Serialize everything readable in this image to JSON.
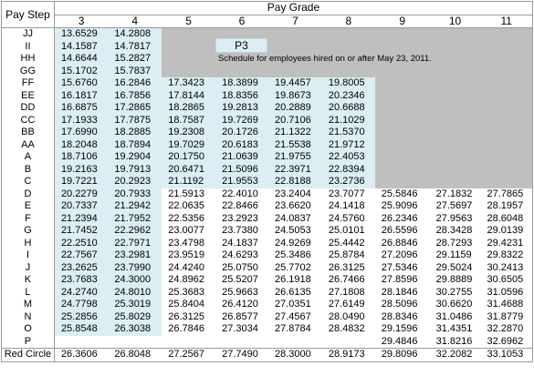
{
  "header": {
    "pay_step_label": "Pay Step",
    "pay_grade_label": "Pay Grade",
    "grades": [
      "3",
      "4",
      "5",
      "6",
      "7",
      "8",
      "9",
      "10",
      "11"
    ]
  },
  "overlay": {
    "schedule_code": "P3",
    "note": "Schedule for employees hired on or after May 23, 2011."
  },
  "rows": [
    {
      "step": "JJ",
      "values": [
        "13.6529",
        "14.2808",
        "",
        "",
        "",
        "",
        "",
        "",
        ""
      ]
    },
    {
      "step": "II",
      "values": [
        "14.1587",
        "14.7817",
        "",
        "",
        "",
        "",
        "",
        "",
        ""
      ]
    },
    {
      "step": "HH",
      "values": [
        "14.6644",
        "15.2827",
        "",
        "",
        "",
        "",
        "",
        "",
        ""
      ]
    },
    {
      "step": "GG",
      "values": [
        "15.1702",
        "15.7837",
        "",
        "",
        "",
        "",
        "",
        "",
        ""
      ]
    },
    {
      "step": "FF",
      "values": [
        "15.6760",
        "16.2846",
        "17.3423",
        "18.3899",
        "19.4457",
        "19.8005",
        "",
        "",
        ""
      ]
    },
    {
      "step": "EE",
      "values": [
        "16.1817",
        "16.7856",
        "17.8144",
        "18.8356",
        "19.8673",
        "20.2346",
        "",
        "",
        ""
      ]
    },
    {
      "step": "DD",
      "values": [
        "16.6875",
        "17.2865",
        "18.2865",
        "19.2813",
        "20.2889",
        "20.6688",
        "",
        "",
        ""
      ]
    },
    {
      "step": "CC",
      "values": [
        "17.1933",
        "17.7875",
        "18.7587",
        "19.7269",
        "20.7106",
        "21.1029",
        "",
        "",
        ""
      ]
    },
    {
      "step": "BB",
      "values": [
        "17.6990",
        "18.2885",
        "19.2308",
        "20.1726",
        "21.1322",
        "21.5370",
        "",
        "",
        ""
      ]
    },
    {
      "step": "AA",
      "values": [
        "18.2048",
        "18.7894",
        "19.7029",
        "20.6183",
        "21.5538",
        "21.9712",
        "",
        "",
        ""
      ]
    },
    {
      "step": "A",
      "values": [
        "18.7106",
        "19.2904",
        "20.1750",
        "21.0639",
        "21.9755",
        "22.4053",
        "",
        "",
        ""
      ]
    },
    {
      "step": "B",
      "values": [
        "19.2163",
        "19.7913",
        "20.6471",
        "21.5096",
        "22.3971",
        "22.8394",
        "",
        "",
        ""
      ]
    },
    {
      "step": "C",
      "values": [
        "19.7221",
        "20.2923",
        "21.1192",
        "21.9553",
        "22.8188",
        "23.2736",
        "",
        "",
        ""
      ]
    },
    {
      "step": "D",
      "values": [
        "20.2279",
        "20.7933",
        "21.5913",
        "22.4010",
        "23.2404",
        "23.7077",
        "25.5846",
        "27.1832",
        "27.7865"
      ]
    },
    {
      "step": "E",
      "values": [
        "20.7337",
        "21.2942",
        "22.0635",
        "22.8466",
        "23.6620",
        "24.1418",
        "25.9096",
        "27.5697",
        "28.1957"
      ]
    },
    {
      "step": "F",
      "values": [
        "21.2394",
        "21.7952",
        "22.5356",
        "23.2923",
        "24.0837",
        "24.5760",
        "26.2346",
        "27.9563",
        "28.6048"
      ]
    },
    {
      "step": "G",
      "values": [
        "21.7452",
        "22.2962",
        "23.0077",
        "23.7380",
        "24.5053",
        "25.0101",
        "26.5596",
        "28.3428",
        "29.0139"
      ]
    },
    {
      "step": "H",
      "values": [
        "22.2510",
        "22.7971",
        "23.4798",
        "24.1837",
        "24.9269",
        "25.4442",
        "26.8846",
        "28.7293",
        "29.4231"
      ]
    },
    {
      "step": "I",
      "values": [
        "22.7567",
        "23.2981",
        "23.9519",
        "24.6293",
        "25.3486",
        "25.8784",
        "27.2096",
        "29.1159",
        "29.8322"
      ]
    },
    {
      "step": "J",
      "values": [
        "23.2625",
        "23.7990",
        "24.4240",
        "25.0750",
        "25.7702",
        "26.3125",
        "27.5346",
        "29.5024",
        "30.2413"
      ]
    },
    {
      "step": "K",
      "values": [
        "23.7683",
        "24.3000",
        "24.8962",
        "25.5207",
        "26.1918",
        "26.7466",
        "27.8596",
        "29.8889",
        "30.6505"
      ]
    },
    {
      "step": "L",
      "values": [
        "24.2740",
        "24.8010",
        "25.3683",
        "25.9663",
        "26.6135",
        "27.1808",
        "28.1846",
        "30.2755",
        "31.0596"
      ]
    },
    {
      "step": "M",
      "values": [
        "24.7798",
        "25.3019",
        "25.8404",
        "26.4120",
        "27.0351",
        "27.6149",
        "28.5096",
        "30.6620",
        "31.4688"
      ]
    },
    {
      "step": "N",
      "values": [
        "25.2856",
        "25.8029",
        "26.3125",
        "26.8577",
        "27.4567",
        "28.0490",
        "28.8346",
        "31.0486",
        "31.8779"
      ]
    },
    {
      "step": "O",
      "values": [
        "25.8548",
        "26.3038",
        "26.7846",
        "27.3034",
        "27.8784",
        "28.4832",
        "29.1596",
        "31.4351",
        "32.2870"
      ]
    },
    {
      "step": "P",
      "values": [
        "",
        "",
        "",
        "",
        "",
        "",
        "29.4846",
        "31.8216",
        "32.6962"
      ]
    }
  ],
  "red_circle": {
    "label": "Red Circle",
    "values": [
      "26.3606",
      "26.8048",
      "27.2567",
      "27.7490",
      "28.3000",
      "28.9173",
      "29.8096",
      "32.2082",
      "33.1053"
    ]
  }
}
